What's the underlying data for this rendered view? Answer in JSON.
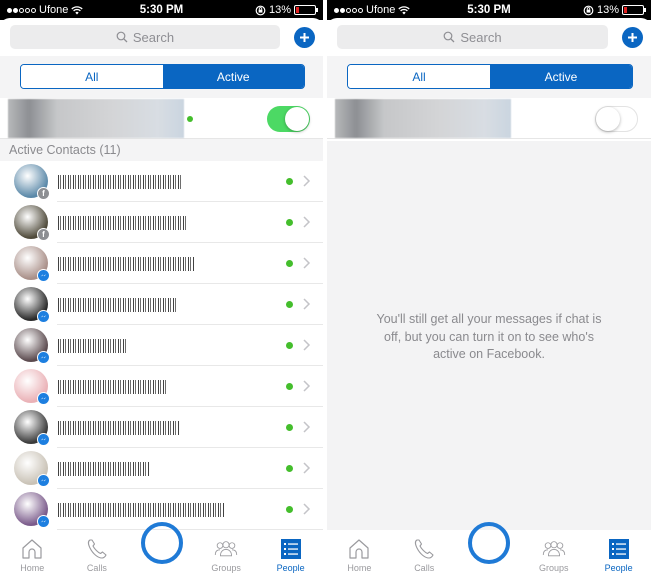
{
  "screens": [
    {
      "status_bar": {
        "carrier": "Ufone",
        "time": "5:30 PM",
        "battery": "13%",
        "battery_level": 0.13,
        "signal_bars_filled": 2,
        "signal_bars_total": 5
      },
      "search": {
        "placeholder": "Search"
      },
      "add_button_icon": "plus-icon",
      "segments": [
        {
          "label": "All",
          "active": false
        },
        {
          "label": "Active",
          "active": true
        }
      ],
      "chat_toggle": {
        "state": "on"
      },
      "section_header": "Active Contacts (11)",
      "contacts": [
        {
          "avatar_color": "#5a88a8",
          "badge": "facebook",
          "online": true
        },
        {
          "avatar_color": "#4f4a3a",
          "badge": "facebook",
          "online": true
        },
        {
          "avatar_color": "#a98f88",
          "badge": "messenger",
          "online": true
        },
        {
          "avatar_color": "#2a2a2a",
          "badge": "messenger",
          "online": true
        },
        {
          "avatar_color": "#5b4a4e",
          "badge": "messenger",
          "online": true
        },
        {
          "avatar_color": "#eab1b6",
          "badge": "messenger",
          "online": true
        },
        {
          "avatar_color": "#3a3a3a",
          "badge": "messenger",
          "online": true
        },
        {
          "avatar_color": "#c9c2b6",
          "badge": "messenger",
          "online": true
        },
        {
          "avatar_color": "#7a5a8a",
          "badge": "messenger",
          "online": true
        }
      ],
      "tabs": [
        {
          "label": "Home",
          "icon": "home-icon",
          "active": false
        },
        {
          "label": "Calls",
          "icon": "phone-icon",
          "active": false
        },
        {
          "label": "",
          "icon": "camera-ring-icon",
          "active": false
        },
        {
          "label": "Groups",
          "icon": "groups-icon",
          "active": false
        },
        {
          "label": "People",
          "icon": "people-list-icon",
          "active": true
        }
      ]
    },
    {
      "status_bar": {
        "carrier": "Ufone",
        "time": "5:30 PM",
        "battery": "13%",
        "battery_level": 0.13,
        "signal_bars_filled": 2,
        "signal_bars_total": 5
      },
      "search": {
        "placeholder": "Search"
      },
      "add_button_icon": "plus-icon",
      "segments": [
        {
          "label": "All",
          "active": false
        },
        {
          "label": "Active",
          "active": true
        }
      ],
      "chat_toggle": {
        "state": "off"
      },
      "empty_message": "You'll still get all your messages if chat is off, but you can turn it on to see who's active on Facebook.",
      "tabs": [
        {
          "label": "Home",
          "icon": "home-icon",
          "active": false
        },
        {
          "label": "Calls",
          "icon": "phone-icon",
          "active": false
        },
        {
          "label": "",
          "icon": "camera-ring-icon",
          "active": false
        },
        {
          "label": "Groups",
          "icon": "groups-icon",
          "active": false
        },
        {
          "label": "People",
          "icon": "people-list-icon",
          "active": true
        }
      ]
    }
  ],
  "colors": {
    "accent": "#0a66c2",
    "online": "#44be2c",
    "toggle_on": "#4cd964",
    "battery_low": "#e02020",
    "camera_ring": "#1f7ad6"
  }
}
